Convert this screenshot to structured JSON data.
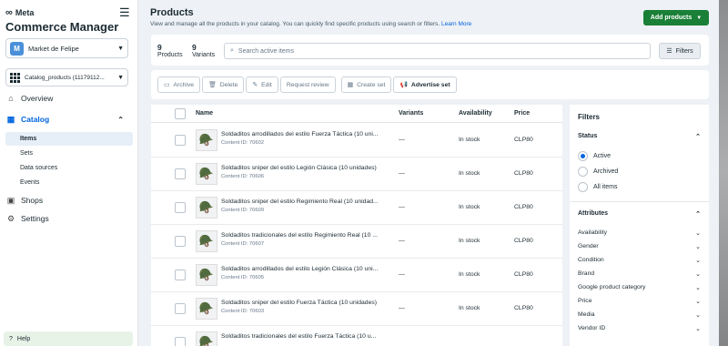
{
  "brand": {
    "logo_text": "Meta",
    "app_title": "Commerce Manager"
  },
  "account": {
    "initial": "M",
    "name": "Market de Felipe"
  },
  "catalog_selector": {
    "label": "Catalog_products (11179112..."
  },
  "nav": {
    "overview": "Overview",
    "catalog": "Catalog",
    "catalog_sub": [
      "Items",
      "Sets",
      "Data sources",
      "Events"
    ],
    "shops": "Shops",
    "settings": "Settings",
    "help": "Help"
  },
  "header": {
    "title": "Products",
    "description": "View and manage all the products in your catalog. You can quickly find specific products using search or filters.",
    "learn_more": "Learn More",
    "add_button": "Add products"
  },
  "summary": {
    "products_count": "9",
    "products_label": "Products",
    "variants_count": "9",
    "variants_label": "Variants"
  },
  "search": {
    "placeholder": "Search active items"
  },
  "filters_button": "Filters",
  "toolbar": [
    "Archive",
    "Delete",
    "Edit",
    "Request review",
    "Create set",
    "Advertise set"
  ],
  "table": {
    "headers": {
      "name": "Name",
      "variants": "Variants",
      "availability": "Availability",
      "price": "Price"
    },
    "rows": [
      {
        "name": "Soldaditos arrodillados del estilo Fuerza Táctica (10 uni...",
        "content_id": "Content ID: 70602",
        "variants": "—",
        "availability": "In stock",
        "price": "CLP80"
      },
      {
        "name": "Soldaditos sniper del estilo Legión Clásica (10 unidades)",
        "content_id": "Content ID: 70606",
        "variants": "—",
        "availability": "In stock",
        "price": "CLP80"
      },
      {
        "name": "Soldaditos sniper del estilo Regimiento Real (10 unidad...",
        "content_id": "Content ID: 70609",
        "variants": "—",
        "availability": "In stock",
        "price": "CLP80"
      },
      {
        "name": "Soldaditos tradicionales del estilo Regimiento Real (10 ...",
        "content_id": "Content ID: 70607",
        "variants": "—",
        "availability": "In stock",
        "price": "CLP80"
      },
      {
        "name": "Soldaditos arrodillados del estilo Legión Clásica (10 uni...",
        "content_id": "Content ID: 70605",
        "variants": "—",
        "availability": "In stock",
        "price": "CLP80"
      },
      {
        "name": "Soldaditos sniper del estilo Fuerza Táctica (10 unidades)",
        "content_id": "Content ID: 70603",
        "variants": "—",
        "availability": "In stock",
        "price": "CLP80"
      },
      {
        "name": "Soldaditos tradicionales del estilo Fuerza Táctica (10 u...",
        "content_id": "",
        "variants": "",
        "availability": "",
        "price": ""
      }
    ]
  },
  "filters_panel": {
    "title": "Filters",
    "status_label": "Status",
    "status_options": [
      "Active",
      "Archived",
      "All items"
    ],
    "attributes_label": "Attributes",
    "attributes": [
      "Availability",
      "Gender",
      "Condition",
      "Brand",
      "Google product category",
      "Price",
      "Media",
      "Vendor ID"
    ]
  },
  "colors": {
    "accent": "#0064e0",
    "primary_button": "#1a7f37"
  }
}
